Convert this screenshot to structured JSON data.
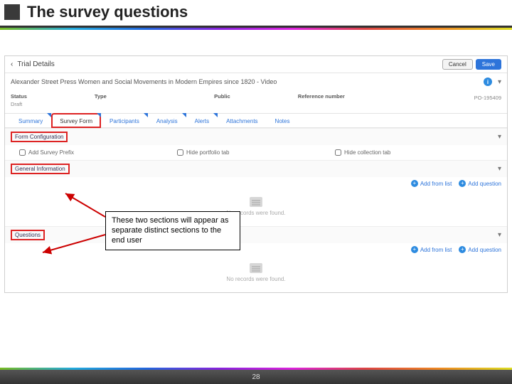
{
  "slide": {
    "title": "The survey questions",
    "page_number": "28"
  },
  "app": {
    "back_label": "Trial Details",
    "buttons": {
      "cancel": "Cancel",
      "save": "Save"
    },
    "record_title": "Alexander Street Press Women and Social Movements in Modern Empires since 1820 - Video",
    "meta": {
      "status_label": "Status",
      "status_value": "Draft",
      "type_label": "Type",
      "type_value": "",
      "public_label": "Public",
      "ref_label": "Reference number",
      "ref_value": "PO-195409"
    },
    "tabs": {
      "summary": "Summary",
      "survey_form": "Survey Form",
      "participants": "Participants",
      "analysis": "Analysis",
      "alerts": "Alerts",
      "attachments": "Attachments",
      "notes": "Notes"
    },
    "sections": {
      "form_config": {
        "title": "Form Configuration",
        "add_survey_prefix": "Add Survey Prefix",
        "hide_portfolio": "Hide portfolio tab",
        "hide_collection": "Hide collection tab"
      },
      "general_info": {
        "title": "General Information",
        "add_from_list": "Add from list",
        "add_question": "Add question",
        "empty": "No records were found."
      },
      "questions": {
        "title": "Questions",
        "add_from_list": "Add from list",
        "add_question": "Add question",
        "empty": "No records were found."
      }
    }
  },
  "callout": {
    "text": "These two sections will appear as separate distinct sections to the end user"
  }
}
